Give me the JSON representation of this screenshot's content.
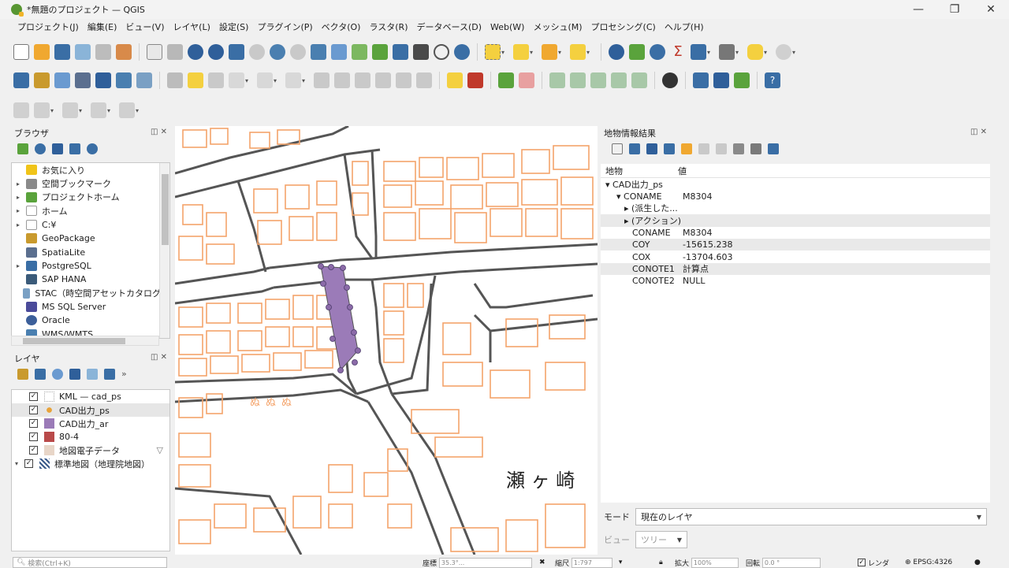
{
  "window": {
    "title": "*無題のプロジェクト — QGIS",
    "controls": {
      "minimize": "—",
      "restore": "❐",
      "close": "✕"
    }
  },
  "menu": [
    "プロジェクト(J)",
    "編集(E)",
    "ビュー(V)",
    "レイヤ(L)",
    "設定(S)",
    "プラグイン(P)",
    "ベクタ(O)",
    "ラスタ(R)",
    "データベース(D)",
    "Web(W)",
    "メッシュ(M)",
    "プロセシング(C)",
    "ヘルプ(H)"
  ],
  "browser": {
    "title": "ブラウザ",
    "items": [
      {
        "label": "お気に入り",
        "arrow": "",
        "icon": "star-icon",
        "color": "#f0c419"
      },
      {
        "label": "空間ブックマーク",
        "arrow": "▸",
        "icon": "bookmark-icon",
        "color": "#8a8a8a"
      },
      {
        "label": "プロジェクトホーム",
        "arrow": "▸",
        "icon": "project-home-icon",
        "color": "#5aa33c"
      },
      {
        "label": "ホーム",
        "arrow": "▸",
        "icon": "home-icon",
        "color": "#9a9a9a"
      },
      {
        "label": "C:¥",
        "arrow": "▸",
        "icon": "drive-icon",
        "color": "#9a9a9a"
      },
      {
        "label": "GeoPackage",
        "arrow": "",
        "icon": "geopackage-icon",
        "color": "#c99a2e"
      },
      {
        "label": "SpatiaLite",
        "arrow": "",
        "icon": "spatialite-icon",
        "color": "#5b6f8f"
      },
      {
        "label": "PostgreSQL",
        "arrow": "▸",
        "icon": "postgresql-icon",
        "color": "#3a6ea5"
      },
      {
        "label": "SAP HANA",
        "arrow": "",
        "icon": "sap-hana-icon",
        "color": "#3b5b7a"
      },
      {
        "label": "STAC（時空間アセットカタログ）",
        "arrow": "",
        "icon": "stac-icon",
        "color": "#7aa0c4"
      },
      {
        "label": "MS SQL Server",
        "arrow": "",
        "icon": "mssql-icon",
        "color": "#4b4b9a"
      },
      {
        "label": "Oracle",
        "arrow": "",
        "icon": "oracle-icon",
        "color": "#3c5f9a"
      },
      {
        "label": "WMS/WMTS",
        "arrow": "",
        "icon": "wms-icon",
        "color": "#4a7fb0"
      }
    ]
  },
  "layers": {
    "title": "レイヤ",
    "items": [
      {
        "label": "KML — cad_ps",
        "checked": "✓",
        "icon": "points-icon",
        "expand": "",
        "color": "#c0c0c0"
      },
      {
        "label": "CAD出力_ps",
        "checked": "✓",
        "icon": "point-icon",
        "expand": "",
        "color": "#e8a33a"
      },
      {
        "label": "CAD出力_ar",
        "checked": "✓",
        "icon": "polygon-icon",
        "expand": "",
        "color": "#9b7bb8"
      },
      {
        "label": "80-4",
        "checked": "✓",
        "icon": "polygon-icon",
        "expand": "",
        "color": "#b94a4a"
      },
      {
        "label": "地図電子データ",
        "checked": "✓",
        "icon": "polygon-icon",
        "expand": "",
        "color": "#e8d6c8"
      },
      {
        "label": "標準地図（地理院地図）",
        "checked": "✓",
        "icon": "raster-icon",
        "expand": "▾",
        "color": "#3a5a8a"
      }
    ]
  },
  "identify": {
    "title": "地物情報結果",
    "header": {
      "feature": "地物",
      "value": "値"
    },
    "rows": [
      {
        "key": "▾ CAD出力_ps",
        "value": "",
        "indent": 0,
        "alt": false
      },
      {
        "key": "▾ CONAME",
        "value": "M8304",
        "indent": 1,
        "alt": false
      },
      {
        "key": "▸ (派生した...",
        "value": "",
        "indent": 2,
        "alt": false
      },
      {
        "key": "▸ (アクション)",
        "value": "",
        "indent": 2,
        "alt": true
      },
      {
        "key": "CONAME",
        "value": "M8304",
        "indent": 3,
        "alt": false
      },
      {
        "key": "COY",
        "value": "-15615.238",
        "indent": 3,
        "alt": true
      },
      {
        "key": "COX",
        "value": "-13704.603",
        "indent": 3,
        "alt": false
      },
      {
        "key": "CONOTE1",
        "value": "計算点",
        "indent": 3,
        "alt": true
      },
      {
        "key": "CONOTE2",
        "value": "NULL",
        "indent": 3,
        "alt": false
      }
    ],
    "mode_label": "モード",
    "mode_value": "現在のレイヤ",
    "view_label": "ビュー",
    "view_value": "ツリー"
  },
  "map": {
    "label": "瀬 ヶ 崎",
    "road_color": "#555555",
    "building_color": "#f4a36a",
    "selected_fill": "#9b7bb8"
  },
  "status": {
    "search_placeholder": "検索(Ctrl+K)",
    "coord_label": "座標",
    "coord_value": "35.3°...",
    "scale_label": "縮尺",
    "scale_value": "1:797",
    "magnify_label": "拡大",
    "magnify_value": "100%",
    "rotation_label": "回転",
    "rotation_value": "0.0 °",
    "render_label": "レンダ",
    "crs": "EPSG:4326"
  }
}
